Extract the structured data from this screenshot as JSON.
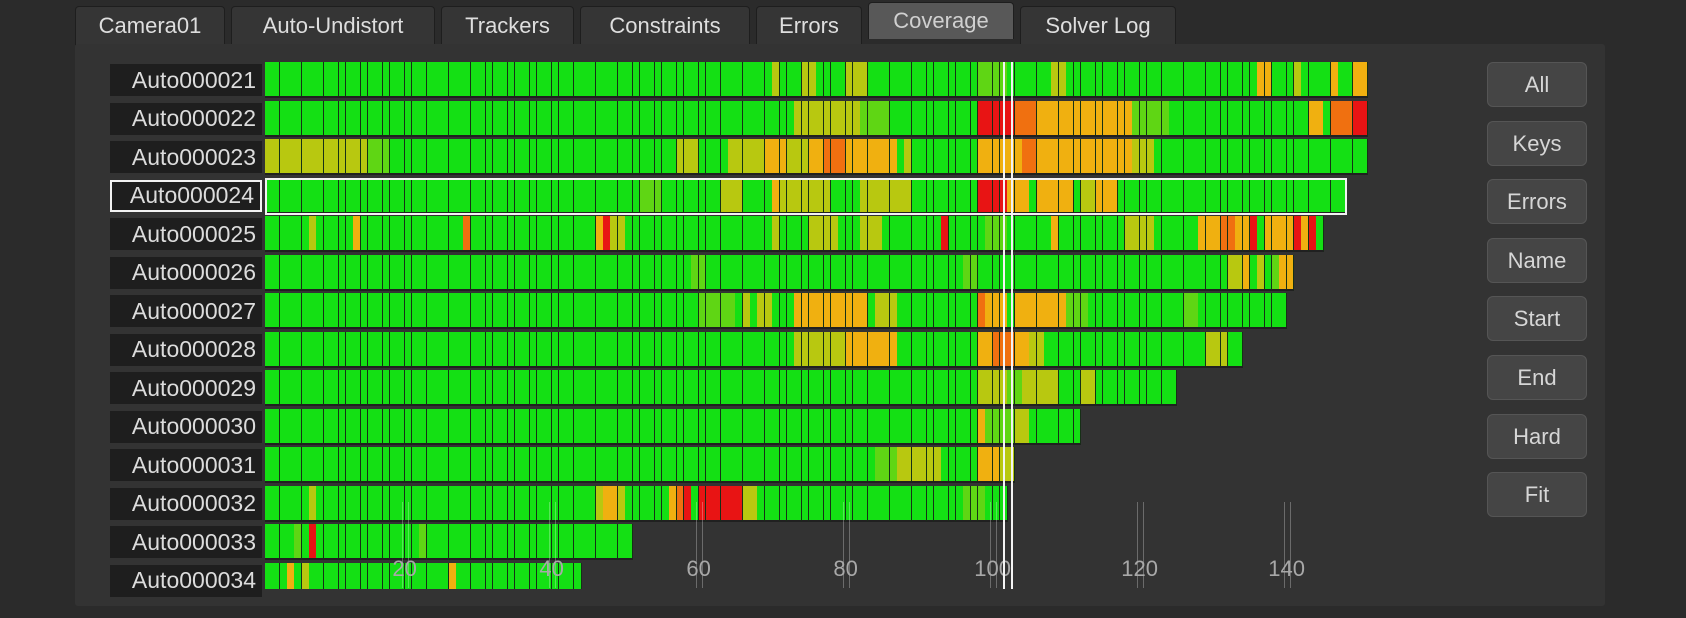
{
  "tabs": [
    {
      "label": "Camera01",
      "active": false
    },
    {
      "label": "Auto-Undistort",
      "active": false
    },
    {
      "label": "Trackers",
      "active": false
    },
    {
      "label": "Constraints",
      "active": false
    },
    {
      "label": "Errors",
      "active": false
    },
    {
      "label": "Coverage",
      "active": true
    },
    {
      "label": "Solver Log",
      "active": false
    }
  ],
  "coverage": {
    "frame_min": 1,
    "frame_max": 150,
    "current_frame": 102,
    "selected_tracker": "Auto000024",
    "axis_ticks": [
      20,
      40,
      60,
      80,
      100,
      120,
      140
    ],
    "colors": {
      "good": "#14e014",
      "ok": "#5fd614",
      "warn": "#b8c810",
      "mid": "#f0b010",
      "high": "#f07010",
      "bad": "#e81414"
    },
    "trackers": [
      {
        "name": "Auto000021",
        "start": 1,
        "end": 150,
        "issues": [
          [
            70,
            1,
            "warn"
          ],
          [
            74,
            2,
            "warn"
          ],
          [
            80,
            3,
            "warn"
          ],
          [
            98,
            4,
            "ok"
          ],
          [
            108,
            2,
            "warn"
          ],
          [
            136,
            2,
            "mid"
          ],
          [
            141,
            1,
            "warn"
          ],
          [
            146,
            1,
            "mid"
          ],
          [
            149,
            2,
            "mid"
          ]
        ]
      },
      {
        "name": "Auto000022",
        "start": 1,
        "end": 150,
        "issues": [
          [
            73,
            9,
            "warn"
          ],
          [
            82,
            4,
            "ok"
          ],
          [
            98,
            5,
            "bad"
          ],
          [
            103,
            3,
            "high"
          ],
          [
            106,
            13,
            "mid"
          ],
          [
            119,
            5,
            "ok"
          ],
          [
            143,
            2,
            "mid"
          ],
          [
            146,
            4,
            "high"
          ],
          [
            149,
            2,
            "bad"
          ]
        ]
      },
      {
        "name": "Auto000023",
        "start": 1,
        "end": 150,
        "issues": [
          [
            1,
            14,
            "warn"
          ],
          [
            15,
            3,
            "ok"
          ],
          [
            57,
            3,
            "warn"
          ],
          [
            64,
            5,
            "warn"
          ],
          [
            69,
            3,
            "mid"
          ],
          [
            72,
            3,
            "warn"
          ],
          [
            75,
            2,
            "mid"
          ],
          [
            77,
            3,
            "high"
          ],
          [
            80,
            7,
            "mid"
          ],
          [
            88,
            1,
            "warn"
          ],
          [
            98,
            6,
            "mid"
          ],
          [
            104,
            2,
            "high"
          ],
          [
            106,
            13,
            "mid"
          ],
          [
            119,
            3,
            "warn"
          ]
        ]
      },
      {
        "name": "Auto000024",
        "start": 1,
        "end": 147,
        "issues": [
          [
            52,
            3,
            "ok"
          ],
          [
            63,
            3,
            "warn"
          ],
          [
            70,
            1,
            "mid"
          ],
          [
            71,
            7,
            "warn"
          ],
          [
            82,
            7,
            "warn"
          ],
          [
            98,
            4,
            "bad"
          ],
          [
            102,
            3,
            "mid"
          ],
          [
            106,
            5,
            "mid"
          ],
          [
            112,
            2,
            "warn"
          ],
          [
            114,
            3,
            "mid"
          ]
        ]
      },
      {
        "name": "Auto000025",
        "start": 1,
        "end": 144,
        "issues": [
          [
            7,
            1,
            "warn"
          ],
          [
            13,
            1,
            "mid"
          ],
          [
            28,
            1,
            "high"
          ],
          [
            46,
            1,
            "mid"
          ],
          [
            47,
            1,
            "bad"
          ],
          [
            48,
            2,
            "warn"
          ],
          [
            70,
            1,
            "warn"
          ],
          [
            75,
            4,
            "warn"
          ],
          [
            82,
            3,
            "warn"
          ],
          [
            93,
            1,
            "bad"
          ],
          [
            99,
            3,
            "ok"
          ],
          [
            108,
            1,
            "mid"
          ],
          [
            118,
            4,
            "warn"
          ],
          [
            128,
            3,
            "mid"
          ],
          [
            131,
            2,
            "high"
          ],
          [
            133,
            3,
            "mid"
          ],
          [
            135,
            1,
            "bad"
          ],
          [
            137,
            4,
            "mid"
          ],
          [
            141,
            1,
            "bad"
          ],
          [
            142,
            1,
            "mid"
          ],
          [
            143,
            1,
            "bad"
          ]
        ]
      },
      {
        "name": "Auto000026",
        "start": 1,
        "end": 140,
        "issues": [
          [
            59,
            2,
            "ok"
          ],
          [
            96,
            2,
            "ok"
          ],
          [
            132,
            2,
            "warn"
          ],
          [
            134,
            1,
            "mid"
          ],
          [
            136,
            1,
            "warn"
          ],
          [
            138,
            1,
            "ok"
          ],
          [
            139,
            2,
            "mid"
          ]
        ]
      },
      {
        "name": "Auto000027",
        "start": 1,
        "end": 139,
        "issues": [
          [
            60,
            5,
            "ok"
          ],
          [
            66,
            1,
            "warn"
          ],
          [
            68,
            2,
            "warn"
          ],
          [
            73,
            3,
            "mid"
          ],
          [
            76,
            7,
            "mid"
          ],
          [
            84,
            3,
            "warn"
          ],
          [
            98,
            1,
            "high"
          ],
          [
            99,
            3,
            "mid"
          ],
          [
            103,
            7,
            "mid"
          ],
          [
            110,
            3,
            "ok"
          ],
          [
            126,
            2,
            "ok"
          ]
        ]
      },
      {
        "name": "Auto000028",
        "start": 1,
        "end": 133,
        "issues": [
          [
            73,
            7,
            "warn"
          ],
          [
            80,
            7,
            "mid"
          ],
          [
            98,
            2,
            "mid"
          ],
          [
            100,
            3,
            "high"
          ],
          [
            103,
            2,
            "mid"
          ],
          [
            105,
            2,
            "warn"
          ],
          [
            129,
            3,
            "warn"
          ]
        ]
      },
      {
        "name": "Auto000029",
        "start": 1,
        "end": 124,
        "issues": [
          [
            98,
            4,
            "warn"
          ],
          [
            102,
            2,
            "ok"
          ],
          [
            104,
            5,
            "warn"
          ],
          [
            112,
            2,
            "warn"
          ]
        ]
      },
      {
        "name": "Auto000030",
        "start": 1,
        "end": 111,
        "issues": [
          [
            98,
            1,
            "mid"
          ],
          [
            99,
            4,
            "ok"
          ],
          [
            103,
            2,
            "warn"
          ]
        ]
      },
      {
        "name": "Auto000031",
        "start": 1,
        "end": 102,
        "issues": [
          [
            84,
            3,
            "ok"
          ],
          [
            87,
            6,
            "warn"
          ],
          [
            98,
            3,
            "mid"
          ],
          [
            101,
            2,
            "warn"
          ]
        ]
      },
      {
        "name": "Auto000032",
        "start": 1,
        "end": 101,
        "issues": [
          [
            7,
            1,
            "warn"
          ],
          [
            46,
            1,
            "warn"
          ],
          [
            47,
            2,
            "mid"
          ],
          [
            49,
            1,
            "warn"
          ],
          [
            56,
            1,
            "mid"
          ],
          [
            57,
            1,
            "high"
          ],
          [
            58,
            1,
            "bad"
          ],
          [
            60,
            1,
            "bad"
          ],
          [
            61,
            5,
            "bad"
          ],
          [
            66,
            2,
            "warn"
          ],
          [
            96,
            3,
            "ok"
          ]
        ]
      },
      {
        "name": "Auto000033",
        "start": 1,
        "end": 50,
        "issues": [
          [
            5,
            1,
            "ok"
          ],
          [
            7,
            1,
            "bad"
          ],
          [
            22,
            1,
            "ok"
          ]
        ]
      },
      {
        "name": "Auto000034",
        "start": 1,
        "end": 43,
        "issues": [
          [
            4,
            1,
            "mid"
          ],
          [
            6,
            1,
            "warn"
          ],
          [
            26,
            1,
            "mid"
          ]
        ]
      }
    ]
  },
  "side_buttons": [
    "All",
    "Keys",
    "Errors",
    "Name",
    "Start",
    "End",
    "Hard",
    "Fit"
  ]
}
